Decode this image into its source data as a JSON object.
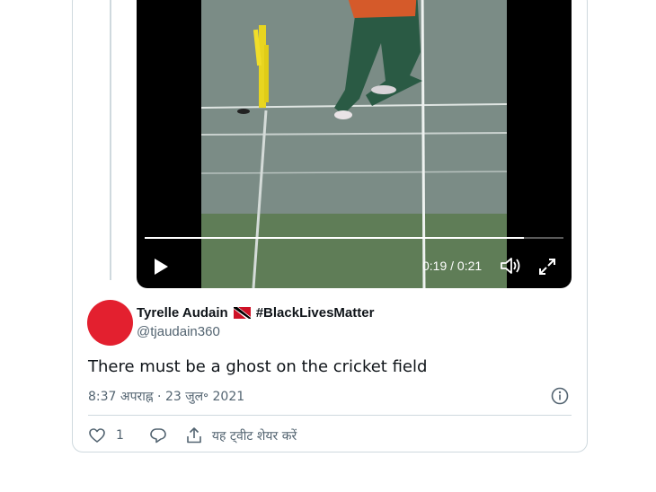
{
  "video": {
    "progress": 0.905,
    "time_display": "0:19 / 0:21",
    "play_icon": "play-icon",
    "volume_icon": "volume-icon",
    "fullscreen_icon": "fullscreen-icon"
  },
  "tweet": {
    "avatar_color": "#e3202f",
    "display_name": "Tyrelle Audain",
    "flag_icon": "trinidad-flag-icon",
    "hashtag_name": "#BlackLivesMatter",
    "handle": "@tjaudain360",
    "text": "There must be a ghost on the cricket field",
    "timestamp": "8:37 अपराह्न · 23 जुल॰ 2021",
    "info_icon": "info-icon",
    "like_count": "1",
    "share_label": "यह ट्वीट शेयर करें"
  },
  "colors": {
    "text_primary": "#0f1419",
    "text_secondary": "#536471",
    "border": "#cfd9de"
  }
}
